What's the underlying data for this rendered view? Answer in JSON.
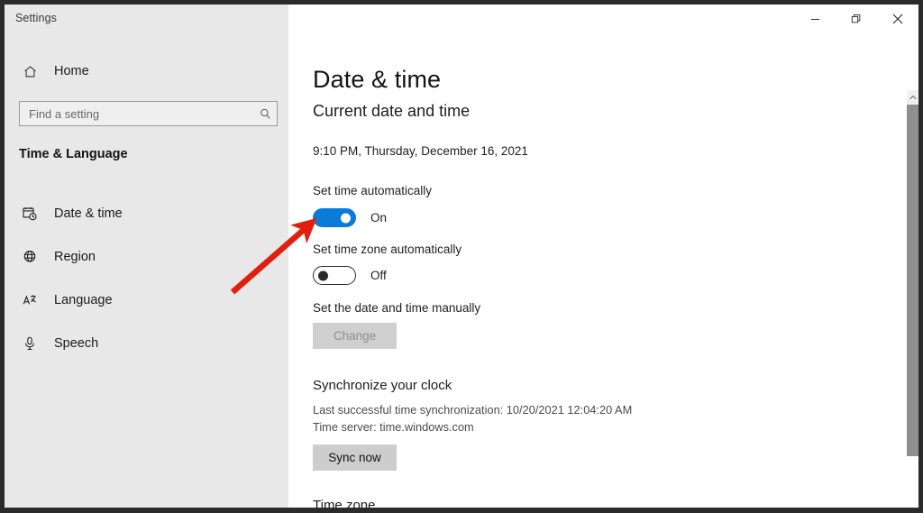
{
  "window": {
    "title": "Settings",
    "controls": {
      "minimize": "minimize-icon",
      "restore": "restore-icon",
      "close": "close-icon"
    }
  },
  "sidebar": {
    "home": {
      "label": "Home",
      "icon": "home-icon"
    },
    "search": {
      "value": "",
      "placeholder": "Find a setting",
      "icon": "search-icon"
    },
    "section_title": "Time & Language",
    "items": [
      {
        "label": "Date & time",
        "icon": "calendar-clock-icon"
      },
      {
        "label": "Region",
        "icon": "globe-icon"
      },
      {
        "label": "Language",
        "icon": "language-icon"
      },
      {
        "label": "Speech",
        "icon": "microphone-icon"
      }
    ]
  },
  "main": {
    "page_title": "Date & time",
    "current_section": {
      "heading": "Current date and time",
      "datetime": "9:10 PM, Thursday, December 16, 2021"
    },
    "set_time_automatically": {
      "label": "Set time automatically",
      "state": "On",
      "checked": true
    },
    "set_timezone_automatically": {
      "label": "Set time zone automatically",
      "state": "Off",
      "checked": false
    },
    "set_manually": {
      "label": "Set the date and time manually",
      "button": "Change",
      "disabled": true
    },
    "synchronize": {
      "heading": "Synchronize your clock",
      "last_sync": "Last successful time synchronization: 10/20/2021 12:04:20 AM",
      "time_server": "Time server: time.windows.com",
      "button": "Sync now"
    },
    "timezone_heading": "Time zone"
  },
  "scrollbar": {
    "up_arrow": "chevron-up-icon"
  },
  "annotation": {
    "type": "arrow",
    "color": "#e01f10",
    "points_to": "set-time-automatically-toggle"
  },
  "colors": {
    "accent": "#0a7bd8",
    "sidebar_bg": "#e8e8e8",
    "content_bg": "#ffffff",
    "frame": "#2b2b2b",
    "annotation_red": "#e01f10"
  }
}
